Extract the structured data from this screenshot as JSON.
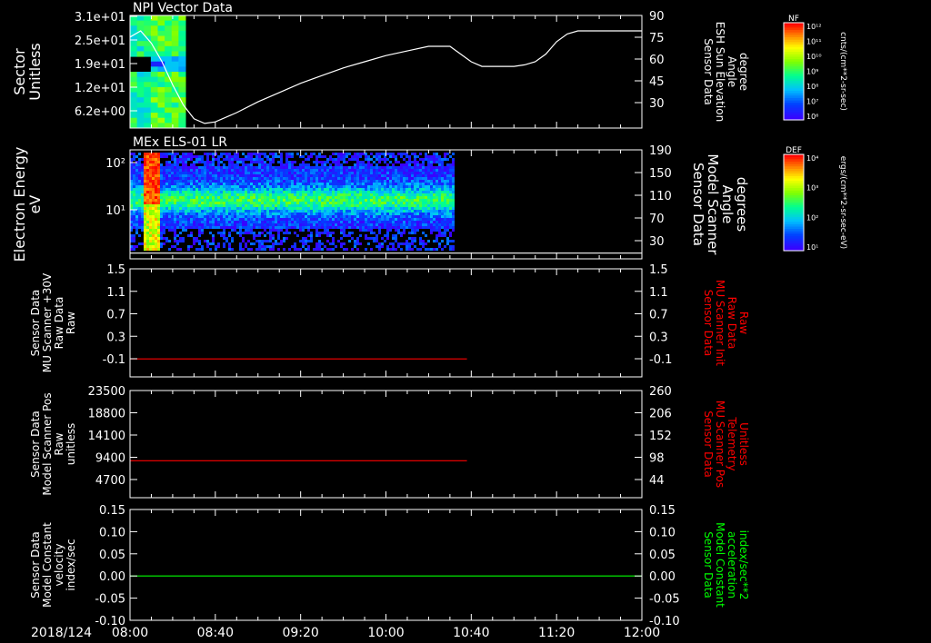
{
  "date": "2018/124",
  "colors": {
    "axis": "#ffffff",
    "red": "#ff0000",
    "green": "#00ff00"
  },
  "time_axis": {
    "range": [
      "08:00",
      "12:00"
    ],
    "range_minutes": [
      0,
      240
    ],
    "ticks": [
      {
        "label": "08:00",
        "minutes": 0
      },
      {
        "label": "08:40",
        "minutes": 40
      },
      {
        "label": "09:20",
        "minutes": 80
      },
      {
        "label": "10:00",
        "minutes": 120
      },
      {
        "label": "10:40",
        "minutes": 160
      },
      {
        "label": "11:20",
        "minutes": 200
      },
      {
        "label": "12:00",
        "minutes": 240
      }
    ]
  },
  "panels": [
    {
      "id": "p1",
      "title": "NPI Vector Data",
      "left_label": [
        "Sector",
        "Unitless"
      ],
      "left_ticks": [
        "3.1e+01",
        "2.5e+01",
        "1.9e+01",
        "1.2e+01",
        "6.2e+00"
      ],
      "right_label": [
        "Sensor Data",
        "ESH Sun Elevation",
        "Angle",
        "degree"
      ],
      "right_ticks": [
        "90",
        "75",
        "60",
        "45",
        "30"
      ],
      "right_color": "#ffffff",
      "colorbar": {
        "name": "NF",
        "unit": "cnts/(cm**2-sr-sec)",
        "ticks": [
          "10¹²",
          "10¹¹",
          "10¹⁰",
          "10⁹",
          "10⁸",
          "10⁷",
          "10⁶"
        ]
      }
    },
    {
      "id": "p2",
      "title": "MEx ELS-01 LR",
      "left_label": [
        "Electron Energy",
        "eV"
      ],
      "left_ticks": [
        "10²",
        "10¹"
      ],
      "right_label": [
        "Sensor Data",
        "Model Scanner",
        "Angle",
        "degrees"
      ],
      "right_ticks": [
        "190",
        "150",
        "110",
        "70",
        "30"
      ],
      "right_color": "#ffffff",
      "colorbar": {
        "name": "DEF",
        "unit": "ergs/(cm**2-sr-sec-eV)",
        "ticks": [
          "10⁴",
          "10³",
          "10²",
          "10¹"
        ]
      }
    },
    {
      "id": "p3",
      "left_label": [
        "Sensor Data",
        "MU Scanner +30V",
        "Raw Data",
        "Raw"
      ],
      "left_ticks": [
        "1.5",
        "1.1",
        "0.7",
        "0.3",
        "-0.1"
      ],
      "right_label": [
        "Sensor Data",
        "MU Scanner Init",
        "Raw Data",
        "Raw"
      ],
      "right_ticks": [
        "1.5",
        "1.1",
        "0.7",
        "0.3",
        "-0.1"
      ],
      "right_color": "#ff0000"
    },
    {
      "id": "p4",
      "left_label": [
        "Sensor Data",
        "Model Scanner Pos",
        "Raw",
        "unitless"
      ],
      "left_ticks": [
        "23500",
        "18800",
        "14100",
        "9400",
        "4700"
      ],
      "right_label": [
        "Sensor Data",
        "MU Scanner Pos",
        "Telemetry",
        "Unitless"
      ],
      "right_ticks": [
        "260",
        "206",
        "152",
        "98",
        "44"
      ],
      "right_color": "#ff0000"
    },
    {
      "id": "p5",
      "left_label": [
        "Sensor Data",
        "Model Constant",
        "velocity",
        "index/sec"
      ],
      "left_ticks": [
        "0.15",
        "0.10",
        "0.05",
        "0.00",
        "-0.05",
        "-0.10"
      ],
      "right_label": [
        "Sensor Data",
        "Model Constant",
        "acceleration",
        "index/sec**2"
      ],
      "right_ticks": [
        "0.15",
        "0.10",
        "0.05",
        "0.00",
        "-0.05",
        "-0.10"
      ],
      "right_color": "#00ff00"
    }
  ],
  "chart_data": [
    {
      "type": "line",
      "panel": "p1",
      "axis": "right",
      "ylim": [
        17,
        90
      ],
      "x_minutes": [
        0,
        5,
        10,
        15,
        20,
        25,
        30,
        35,
        40,
        50,
        60,
        70,
        80,
        90,
        100,
        110,
        120,
        130,
        140,
        150,
        155,
        160,
        165,
        170,
        175,
        180,
        185,
        190,
        195,
        200,
        205,
        210,
        220,
        230,
        240
      ],
      "values": [
        76,
        80,
        72,
        60,
        45,
        32,
        23,
        20,
        21,
        27,
        34,
        40,
        46,
        51,
        56,
        60,
        64,
        67,
        70,
        70,
        65,
        60,
        57,
        57,
        57,
        57,
        58,
        60,
        65,
        73,
        78,
        80,
        80,
        80,
        80
      ]
    },
    {
      "type": "heatmap",
      "panel": "p1",
      "description_free": true,
      "x_minutes": [
        0,
        26
      ],
      "ylim": [
        0,
        31
      ]
    },
    {
      "type": "heatmap",
      "panel": "p2",
      "x_minutes": [
        0,
        152
      ],
      "ylim_log10_eV": [
        0.15,
        2.2
      ]
    },
    {
      "type": "line",
      "panel": "p2",
      "axis": "right",
      "ylim": [
        0,
        190
      ],
      "x_minutes": [
        0,
        240
      ],
      "values": [
        10,
        10
      ]
    },
    {
      "type": "line",
      "panel": "p3",
      "axis": "left",
      "ylim": [
        -0.3,
        1.5
      ],
      "x_minutes": [
        0,
        158
      ],
      "values": [
        0.0,
        0.0
      ],
      "color": "#ff0000"
    },
    {
      "type": "line",
      "panel": "p4",
      "axis": "left",
      "ylim": [
        0,
        23500
      ],
      "x_minutes": [
        0,
        158
      ],
      "values": [
        8100,
        8100
      ],
      "color": "#ff0000"
    },
    {
      "type": "line",
      "panel": "p5",
      "axis": "left",
      "ylim": [
        -0.1,
        0.15
      ],
      "x_minutes": [
        0,
        240
      ],
      "values": [
        0.0,
        0.0
      ],
      "color": "#00ff00"
    }
  ]
}
